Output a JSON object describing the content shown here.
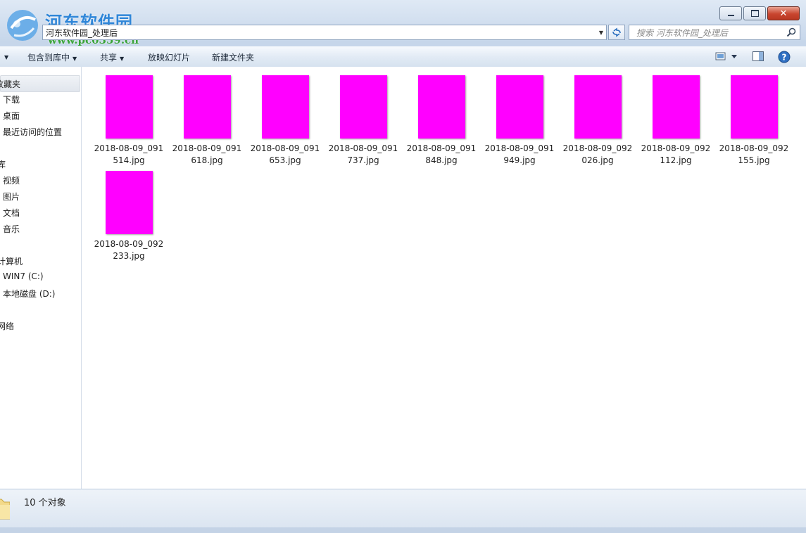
{
  "watermark": {
    "brand": "河东软件园",
    "url": "www.pc0359.cn"
  },
  "address": {
    "path": "河东软件园_处理后"
  },
  "search": {
    "placeholder": "搜索 河东软件园_处理后"
  },
  "toolbar": {
    "include_library": "包含到库中",
    "share": "共享",
    "slideshow": "放映幻灯片",
    "new_folder": "新建文件夹"
  },
  "nav": {
    "favorites": "收藏夹",
    "favorites_items": [
      "下载",
      "桌面",
      "最近访问的位置"
    ],
    "libraries": "库",
    "libraries_items": [
      "视频",
      "图片",
      "文档",
      "音乐"
    ],
    "computer": "计算机",
    "computer_items": [
      "WIN7 (C:)",
      "本地磁盘 (D:)"
    ],
    "network": "网络"
  },
  "files": [
    {
      "line1": "2018-08-09_091",
      "line2": "514.jpg"
    },
    {
      "line1": "2018-08-09_091",
      "line2": "618.jpg"
    },
    {
      "line1": "2018-08-09_091",
      "line2": "653.jpg"
    },
    {
      "line1": "2018-08-09_091",
      "line2": "737.jpg"
    },
    {
      "line1": "2018-08-09_091",
      "line2": "848.jpg"
    },
    {
      "line1": "2018-08-09_091",
      "line2": "949.jpg"
    },
    {
      "line1": "2018-08-09_092",
      "line2": "026.jpg"
    },
    {
      "line1": "2018-08-09_092",
      "line2": "112.jpg"
    },
    {
      "line1": "2018-08-09_092",
      "line2": "155.jpg"
    },
    {
      "line1": "2018-08-09_092",
      "line2": "233.jpg"
    }
  ],
  "thumbnail_color": "#ff00ff",
  "status": {
    "count": "10 个对象"
  },
  "icons": [
    "minimize-icon",
    "maximize-icon",
    "close-icon",
    "refresh-icon",
    "search-icon",
    "view-options-icon",
    "preview-pane-icon",
    "help-icon",
    "folder-icon"
  ]
}
